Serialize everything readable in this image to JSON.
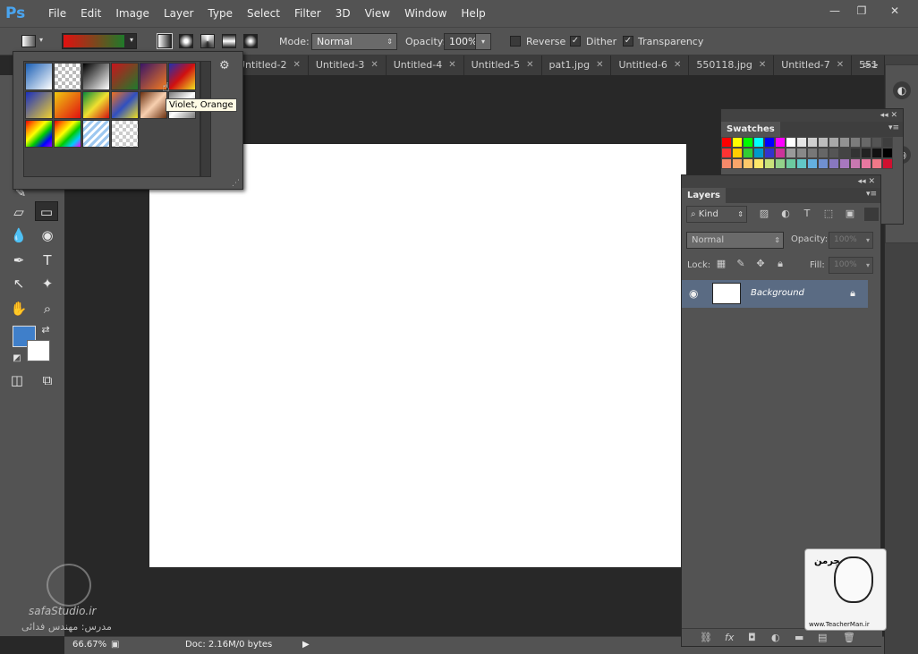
{
  "app": {
    "logo": "Ps"
  },
  "menu": [
    "File",
    "Edit",
    "Image",
    "Layer",
    "Type",
    "Select",
    "Filter",
    "3D",
    "View",
    "Window",
    "Help"
  ],
  "window_controls": {
    "minimize": "—",
    "restore": "❐",
    "close": "✕"
  },
  "options": {
    "mode_label": "Mode:",
    "mode_value": "Normal",
    "opacity_label": "Opacity:",
    "opacity_value": "100%",
    "reverse_label": "Reverse",
    "dither_label": "Dither",
    "transparency_label": "Transparency",
    "reverse_checked": false,
    "dither_checked": true,
    "transparency_checked": true,
    "gradient_colors": [
      "#e21010",
      "#1f7a2a"
    ]
  },
  "tabs": [
    {
      "label": "Untitled-2"
    },
    {
      "label": "Untitled-3"
    },
    {
      "label": "Untitled-4"
    },
    {
      "label": "Untitled-5"
    },
    {
      "label": "pat1.jpg"
    },
    {
      "label": "Untitled-6"
    },
    {
      "label": "550118.jpg"
    },
    {
      "label": "Untitled-7"
    },
    {
      "label": "551"
    }
  ],
  "tab_overflow": ">>",
  "gradient_picker": {
    "tooltip": "Violet, Orange",
    "presets": [
      "linear-gradient(135deg,#1b5fb5,#ffffff)",
      "repeating-conic-gradient(#bbb 0% 25%, #fff 0% 50%) 0 0/8px 8px",
      "linear-gradient(135deg,#000,#fff)",
      "linear-gradient(135deg,#c8141c,#1e7b2c)",
      "linear-gradient(135deg,#3a1666,#f47b20)",
      "linear-gradient(135deg,#2030b0,#d01010,#f0e020)",
      "linear-gradient(135deg,#1a2fc0,#f0d030)",
      "linear-gradient(135deg,#f0c810,#e01010)",
      "linear-gradient(135deg,#0a8a3a,#f0e030,#d01010)",
      "linear-gradient(135deg,#f07020,#3050c0,#f0e020)",
      "linear-gradient(135deg,#6a3010,#f8d0b0,#6a3010)",
      "linear-gradient(135deg,#7a7a7a,#ffffff,#7a7a7a)",
      "linear-gradient(135deg,#e00,#f80,#ff0,#0c0,#00f,#90f)",
      "linear-gradient(135deg,#e00,#f80,#ff0,#0c0,#0cf,#f0f)",
      "repeating-linear-gradient(135deg,#9ec8f0 0 3px,#fff 3px 6px)",
      "repeating-conic-gradient(#ccc 0% 25%, #fff 0% 50%) 0 0/8px 8px"
    ]
  },
  "toolbar": {
    "tools": [
      "⬚",
      "✧",
      "⌖",
      "✎",
      "▭",
      "◈",
      "◉",
      "✒",
      "T",
      "↖",
      "✦",
      "✋",
      "⌕",
      "◫",
      "⧉"
    ],
    "fg_color": "#3f7fca",
    "bg_color": "#ffffff"
  },
  "status": {
    "zoom": "66.67%",
    "doc": "Doc: 2.16M/0 bytes",
    "arrow": "▶"
  },
  "swatches": {
    "title": "Swatches",
    "rows": [
      [
        "#ff0000",
        "#ffff00",
        "#00ff00",
        "#00ffff",
        "#0000ff",
        "#ff00ff",
        "#ffffff",
        "#e6e6e6",
        "#d0d0d0",
        "#bcbcbc",
        "#a8a8a8",
        "#929292",
        "#7c7c7c",
        "#686868",
        "#545454",
        "#3e3e3e"
      ],
      [
        "#ff3333",
        "#ffcc00",
        "#33cc33",
        "#0099cc",
        "#3333cc",
        "#cc3399",
        "#9a9a9a",
        "#888888",
        "#777777",
        "#666666",
        "#555555",
        "#444444",
        "#333333",
        "#222222",
        "#111111",
        "#000000"
      ],
      [
        "#f5896a",
        "#f9a56a",
        "#fdc86a",
        "#fde76a",
        "#c9e27a",
        "#93d18a",
        "#6ccaa0",
        "#62c8c8",
        "#64b0e0",
        "#7090d0",
        "#8878c0",
        "#a878c0",
        "#c878b0",
        "#e878a0",
        "#f07888",
        "#d01030"
      ]
    ]
  },
  "layers": {
    "title": "Layers",
    "filter_label": "Kind",
    "blend_mode": "Normal",
    "opacity_label": "Opacity:",
    "opacity_value": "100%",
    "lock_label": "Lock:",
    "fill_label": "Fill:",
    "fill_value": "100%",
    "layer_name": "Background"
  },
  "watermark": {
    "left_site": "safaStudio.ir",
    "left_name": "مدرس: مهندس فدائی",
    "right_url": "www.TeacherMan.ir",
    "right_brand": "تیچرمن"
  }
}
